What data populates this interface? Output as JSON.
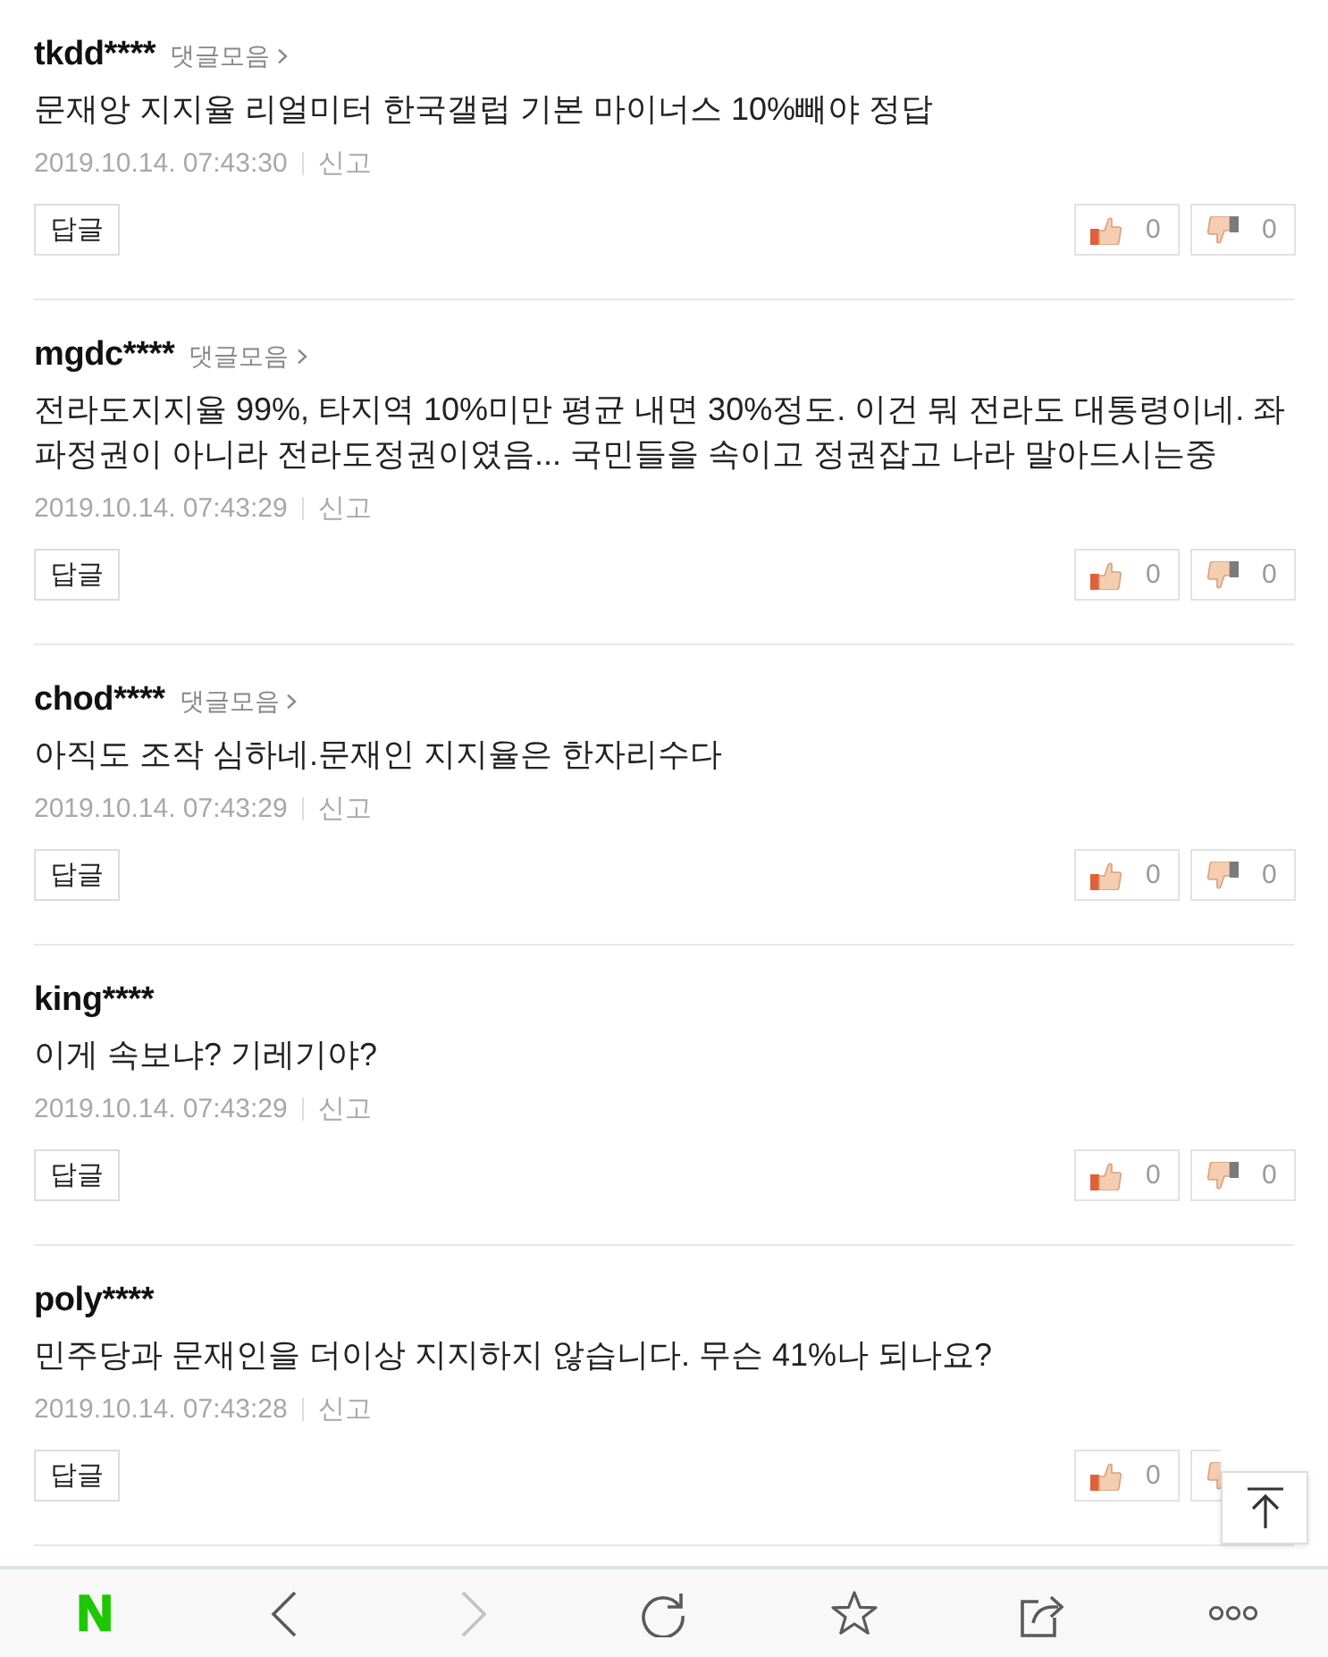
{
  "comments": [
    {
      "author": "tkdd****",
      "replies_link": "댓글모음",
      "text": "문재앙 지지율 리얼미터 한국갤럽 기본 마이너스 10%빼야 정답",
      "time": "2019.10.14. 07:43:30",
      "report": "신고",
      "reply_button": "답글",
      "likes": "0",
      "dislikes": "0"
    },
    {
      "author": "mgdc****",
      "replies_link": "댓글모음",
      "text": "전라도지지율 99%, 타지역 10%미만 평균 내면 30%정도. 이건 뭐 전라도 대통령이네. 좌파정권이 아니라 전라도정권이였음... 국민들을 속이고 정권잡고 나라 말아드시는중",
      "time": "2019.10.14. 07:43:29",
      "report": "신고",
      "reply_button": "답글",
      "likes": "0",
      "dislikes": "0"
    },
    {
      "author": "chod****",
      "replies_link": "댓글모음",
      "text": "아직도 조작 심하네.문재인 지지율은 한자리수다",
      "time": "2019.10.14. 07:43:29",
      "report": "신고",
      "reply_button": "답글",
      "likes": "0",
      "dislikes": "0"
    },
    {
      "author": "king****",
      "text": "이게 속보냐? 기레기야?",
      "time": "2019.10.14. 07:43:29",
      "report": "신고",
      "reply_button": "답글",
      "likes": "0",
      "dislikes": "0"
    },
    {
      "author": "poly****",
      "text": "민주당과 문재인을 더이상 지지하지 않습니다. 무슨 41%나 되나요?",
      "time": "2019.10.14. 07:43:28",
      "report": "신고",
      "reply_button": "답글",
      "likes": "0"
    }
  ],
  "toolbar": {
    "items": [
      {
        "kind": "logo",
        "label": "N",
        "disabled": false
      },
      {
        "kind": "back",
        "disabled": false
      },
      {
        "kind": "forward",
        "disabled": true
      },
      {
        "kind": "reload",
        "disabled": false
      },
      {
        "kind": "bookmark",
        "disabled": false
      },
      {
        "kind": "share",
        "disabled": false
      },
      {
        "kind": "more",
        "disabled": false
      }
    ]
  }
}
